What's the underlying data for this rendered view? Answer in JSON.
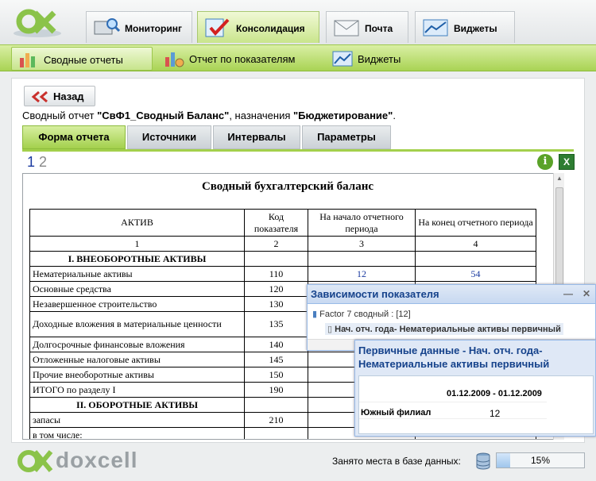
{
  "nav": {
    "tabs": [
      {
        "label": "Мониторинг",
        "icon": "monitor-search-icon"
      },
      {
        "label": "Консолидация",
        "icon": "consolidation-check-icon"
      },
      {
        "label": "Почта",
        "icon": "mail-envelope-icon"
      },
      {
        "label": "Виджеты",
        "icon": "widget-chart-icon"
      }
    ],
    "active_tab": "Консолидация",
    "subtabs": [
      {
        "label": "Сводные отчеты",
        "icon": "bar-chart-icon"
      },
      {
        "label": "Отчет по показателям",
        "icon": "indicator-chart-icon"
      },
      {
        "label": "Виджеты",
        "icon": "widget-chart-icon"
      }
    ],
    "active_subtab": "Сводные отчеты"
  },
  "toolbar": {
    "back_label": "Назад"
  },
  "report": {
    "prefix": "Сводный отчет ",
    "name": "\"СвФ1_Сводный Баланс\"",
    "middle": ", назначения ",
    "purpose": "\"Бюджетирование\"",
    "suffix": "."
  },
  "report_tabs": [
    "Форма отчета",
    "Источники",
    "Интервалы",
    "Параметры"
  ],
  "active_report_tab": "Форма отчета",
  "pagination": {
    "pages": [
      "1",
      "2"
    ],
    "current": "1"
  },
  "document": {
    "title": "Сводный бухгалтерский баланс",
    "headers": [
      "АКТИВ",
      "Код показателя",
      "На начало отчетного периода",
      "На конец отчетного периода"
    ],
    "col_numbers": [
      "1",
      "2",
      "3",
      "4"
    ],
    "section1": "I. ВНЕОБОРОТНЫЕ АКТИВЫ",
    "rows": [
      {
        "name": "Нематериальные активы",
        "code": "110",
        "start": "12",
        "end": "54"
      },
      {
        "name": "Основные средства",
        "code": "120",
        "start": "",
        "end": ""
      },
      {
        "name": "Незавершенное строительство",
        "code": "130",
        "start": "",
        "end": ""
      },
      {
        "name": "Доходные вложения в материальные ценности",
        "code": "135",
        "start": "",
        "end": ""
      },
      {
        "name": "Долгосрочные финансовые вложения",
        "code": "140",
        "start": "",
        "end": ""
      },
      {
        "name": "Отложенные налоговые активы",
        "code": "145",
        "start": "",
        "end": ""
      },
      {
        "name": "Прочие внеоборотные активы",
        "code": "150",
        "start": "",
        "end": ""
      },
      {
        "name": "ИТОГО по разделу I",
        "code": "190",
        "start": "",
        "end": ""
      }
    ],
    "section2": "II. ОБОРОТНЫЕ АКТИВЫ",
    "row_zapasy": {
      "name": "запасы",
      "code": "210"
    },
    "row_including": "в том числе:"
  },
  "dependencies_popup": {
    "title": "Зависимости показателя",
    "root": "Factor 7 сводный : [12]",
    "child": "Нач. отч. года- Нематериальные активы первичный"
  },
  "primary_popup": {
    "title": "Первичные данные - Нач. отч. года- Нематериальные активы первичный",
    "period": "01.12.2009 - 01.12.2009",
    "branch": "Южный филиал",
    "value": "12"
  },
  "footer": {
    "brand": "doxcell",
    "disk_label": "Занято места в базе данных:",
    "disk_usage_percent": 15,
    "disk_usage_text": "15%"
  },
  "colors": {
    "accent_green": "#a3d04c",
    "popup_title_blue": "#15428b",
    "link_blue": "#1a3aa0"
  }
}
